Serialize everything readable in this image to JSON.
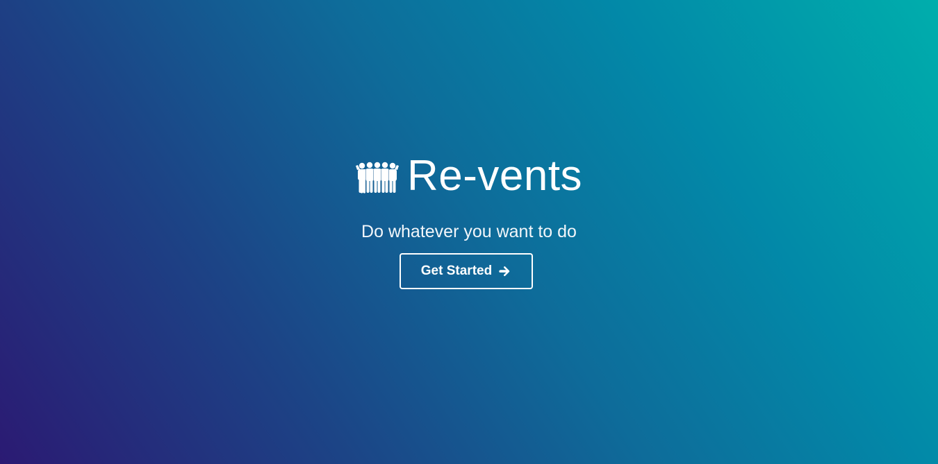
{
  "hero": {
    "logo_icon": "group-of-people-icon",
    "title": "Re-vents",
    "subtitle": "Do whatever you want to do",
    "cta_label": "Get Started",
    "cta_icon": "arrow-right-icon"
  },
  "theme": {
    "gradient_start": "#2b1a73",
    "gradient_end": "#00aeac",
    "text_color": "#ffffff"
  }
}
